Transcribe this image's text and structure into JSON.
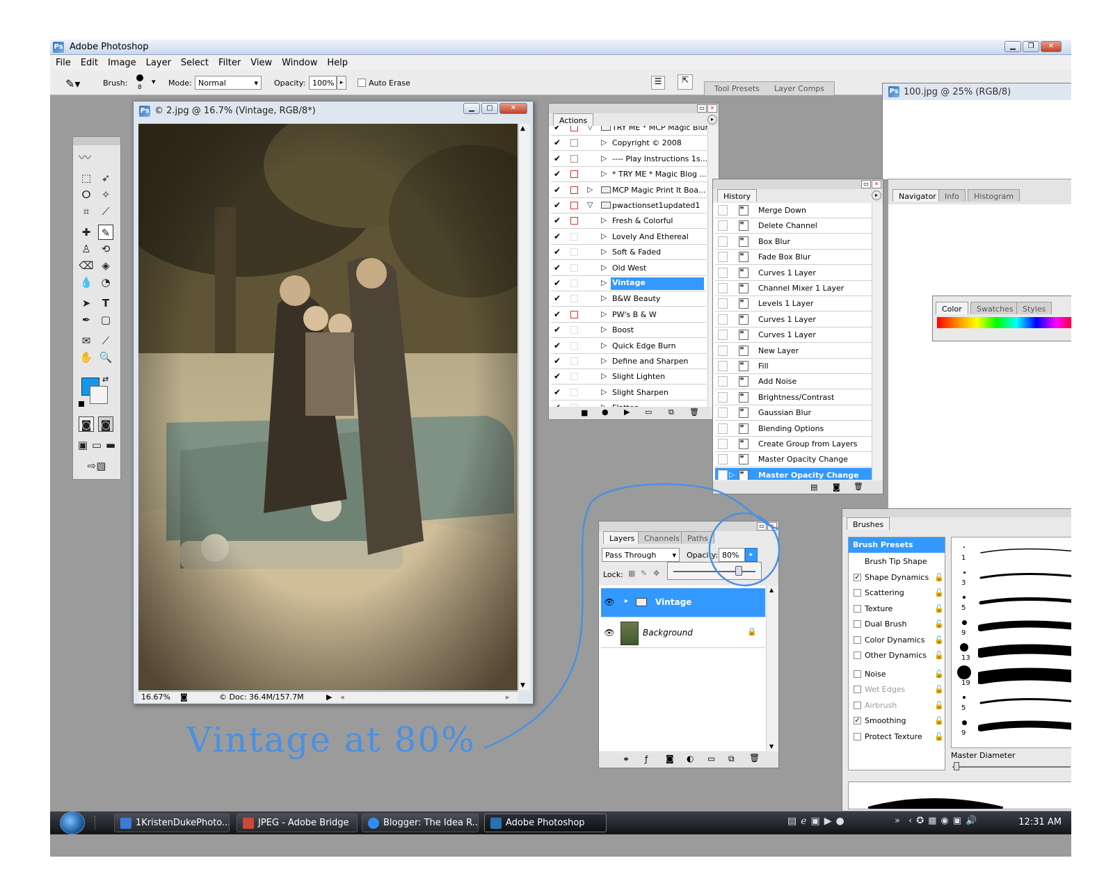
{
  "app": {
    "title": "Adobe Photoshop",
    "menu": [
      "File",
      "Edit",
      "Image",
      "Layer",
      "Select",
      "Filter",
      "View",
      "Window",
      "Help"
    ]
  },
  "options_bar": {
    "brush_label": "Brush:",
    "brush_size": "8",
    "mode_label": "Mode:",
    "mode_value": "Normal",
    "opacity_label": "Opacity:",
    "opacity_value": "100%",
    "auto_erase_label": "Auto Erase",
    "tabs": [
      "Tool Presets",
      "Layer Comps"
    ]
  },
  "document": {
    "title": "© 2.jpg @ 16.7% (Vintage, RGB/8*)",
    "zoom": "16.67%",
    "doc_info": "© Doc: 36.4M/157.7M"
  },
  "second_document": {
    "title": "100.jpg @ 25% (RGB/8)"
  },
  "actions": {
    "tab": "Actions",
    "rows": [
      {
        "label": "TRY ME * MCP Magic Blur",
        "checked": true,
        "dialog": "red",
        "kind": "folder-open-partial"
      },
      {
        "label": "Copyright © 2008",
        "checked": true,
        "dialog": "gray",
        "kind": "action"
      },
      {
        "label": "---- Play Instructions 1s...",
        "checked": true,
        "dialog": "gray",
        "kind": "action"
      },
      {
        "label": "* TRY ME * Magic Blog ...",
        "checked": true,
        "dialog": "red",
        "kind": "action"
      },
      {
        "label": "MCP Magic Print It Boa...",
        "checked": true,
        "dialog": "red",
        "kind": "folder"
      },
      {
        "label": "pwactionset1updated1",
        "checked": true,
        "dialog": "red",
        "kind": "folder-open"
      },
      {
        "label": "Fresh & Colorful",
        "checked": true,
        "dialog": "red",
        "kind": "action"
      },
      {
        "label": "Lovely And Ethereal",
        "checked": true,
        "dialog": "none",
        "kind": "action"
      },
      {
        "label": "Soft & Faded",
        "checked": true,
        "dialog": "none",
        "kind": "action"
      },
      {
        "label": "Old West",
        "checked": true,
        "dialog": "none",
        "kind": "action"
      },
      {
        "label": "Vintage",
        "checked": true,
        "dialog": "none",
        "kind": "action",
        "selected": true
      },
      {
        "label": "B&W Beauty",
        "checked": true,
        "dialog": "none",
        "kind": "action"
      },
      {
        "label": "PW's B & W",
        "checked": true,
        "dialog": "red",
        "kind": "action"
      },
      {
        "label": "Boost",
        "checked": true,
        "dialog": "none",
        "kind": "action"
      },
      {
        "label": "Quick Edge Burn",
        "checked": true,
        "dialog": "none",
        "kind": "action"
      },
      {
        "label": "Define and Sharpen",
        "checked": true,
        "dialog": "none",
        "kind": "action"
      },
      {
        "label": "Slight Lighten",
        "checked": true,
        "dialog": "none",
        "kind": "action"
      },
      {
        "label": "Slight Sharpen",
        "checked": true,
        "dialog": "none",
        "kind": "action"
      },
      {
        "label": "Flatten",
        "checked": true,
        "dialog": "none",
        "kind": "action"
      }
    ]
  },
  "history": {
    "tab": "History",
    "rows": [
      "Merge Down",
      "Delete Channel",
      "Box Blur",
      "Fade Box Blur",
      "Curves 1 Layer",
      "Channel Mixer 1 Layer",
      "Levels 1 Layer",
      "Curves 1 Layer",
      "Curves 1 Layer",
      "New Layer",
      "Fill",
      "Add Noise",
      "Brightness/Contrast",
      "Gaussian Blur",
      "Blending Options",
      "Create Group from Layers",
      "Master Opacity Change",
      "Master Opacity Change"
    ]
  },
  "navigator": {
    "tabs": [
      "Navigator",
      "Info",
      "Histogram"
    ]
  },
  "color_panel": {
    "tabs": [
      "Color",
      "Swatches",
      "Styles"
    ]
  },
  "layers": {
    "tabs": [
      "Layers",
      "Channels",
      "Paths"
    ],
    "blend_mode": "Pass Through",
    "opacity_label": "Opacity:",
    "opacity_value": "80%",
    "opacity_slider_fraction": 0.8,
    "lock_label": "Lock:",
    "rows": [
      {
        "name": "Vintage",
        "kind": "group",
        "selected": true
      },
      {
        "name": "Background",
        "kind": "image",
        "locked": true
      }
    ]
  },
  "brushes": {
    "tab": "Brushes",
    "presets_label": "Brush Presets",
    "options": [
      {
        "label": "Brush Tip Shape",
        "checkbox": false
      },
      {
        "label": "Shape Dynamics",
        "checkbox": true,
        "checked": true
      },
      {
        "label": "Scattering",
        "checkbox": true,
        "checked": false
      },
      {
        "label": "Texture",
        "checkbox": true,
        "checked": false
      },
      {
        "label": "Dual Brush",
        "checkbox": true,
        "checked": false
      },
      {
        "label": "Color Dynamics",
        "checkbox": true,
        "checked": false
      },
      {
        "label": "Other Dynamics",
        "checkbox": true,
        "checked": false
      },
      {
        "label": "Noise",
        "checkbox": true,
        "checked": false
      },
      {
        "label": "Wet Edges",
        "checkbox": true,
        "checked": false,
        "dim": true
      },
      {
        "label": "Airbrush",
        "checkbox": true,
        "checked": false,
        "dim": true
      },
      {
        "label": "Smoothing",
        "checkbox": true,
        "checked": true
      },
      {
        "label": "Protect Texture",
        "checkbox": true,
        "checked": false
      }
    ],
    "preset_sizes": [
      "1",
      "3",
      "5",
      "9",
      "13",
      "19",
      "5",
      "9"
    ],
    "master_diameter_label": "Master Diameter"
  },
  "taskbar": {
    "items": [
      {
        "label": "1KristenDukePhoto...",
        "active": false
      },
      {
        "label": "JPEG - Adobe Bridge",
        "active": false
      },
      {
        "label": "Blogger: The Idea R...",
        "active": false
      },
      {
        "label": "Adobe Photoshop",
        "active": true
      }
    ],
    "clock": "12:31 AM"
  },
  "annotation": {
    "text": "Vintage at 80%",
    "color": "#4a90e2"
  },
  "colors": {
    "selection": "#3399ff",
    "foreground_swatch": "#1199ee",
    "app_background": "#9b9b9b"
  }
}
